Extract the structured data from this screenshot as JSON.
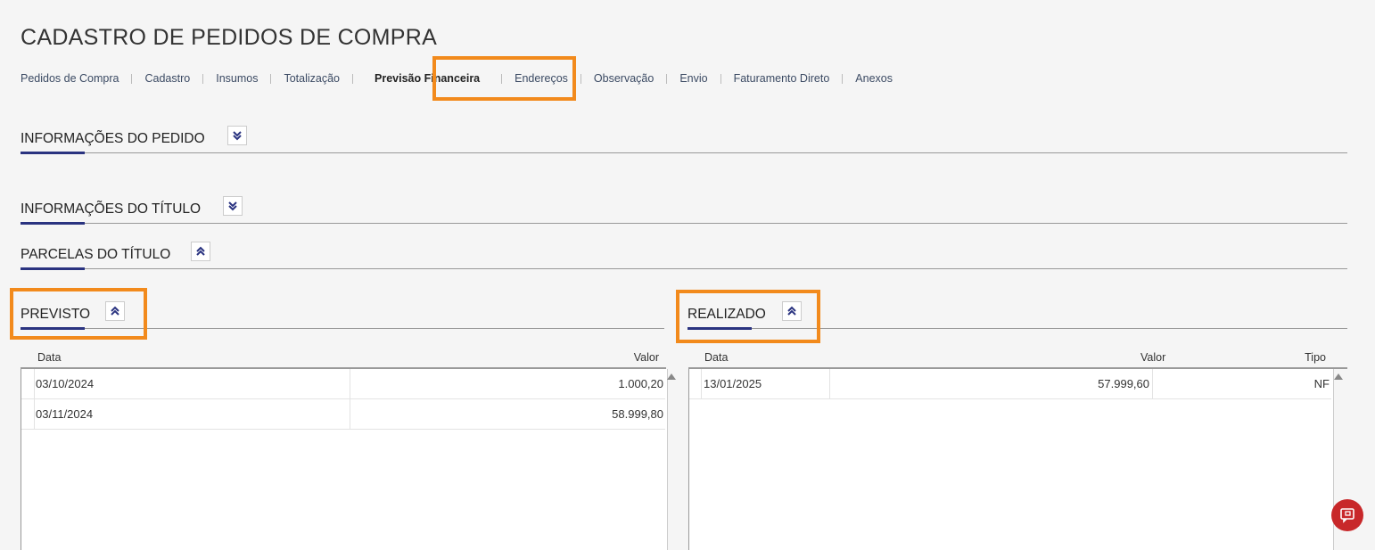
{
  "page": {
    "title": "CADASTRO DE PEDIDOS DE COMPRA"
  },
  "tabs": [
    {
      "label": "Pedidos de Compra"
    },
    {
      "label": "Cadastro"
    },
    {
      "label": "Insumos"
    },
    {
      "label": "Totalização"
    },
    {
      "label": "Previsão Financeira"
    },
    {
      "label": "Endereços"
    },
    {
      "label": "Observação"
    },
    {
      "label": "Envio"
    },
    {
      "label": "Faturamento Direto"
    },
    {
      "label": "Anexos"
    }
  ],
  "active_tab": "Previsão Financeira",
  "sections": {
    "pedido": "INFORMAÇÕES DO PEDIDO",
    "titulo": "INFORMAÇÕES DO TÍTULO",
    "parcelas": "PARCELAS DO TÍTULO"
  },
  "previsto": {
    "title": "PREVISTO",
    "columns": {
      "data": "Data",
      "valor": "Valor"
    },
    "rows": [
      {
        "data": "03/10/2024",
        "valor": "1.000,20"
      },
      {
        "data": "03/11/2024",
        "valor": "58.999,80"
      }
    ]
  },
  "realizado": {
    "title": "REALIZADO",
    "columns": {
      "data": "Data",
      "valor": "Valor",
      "tipo": "Tipo"
    },
    "rows": [
      {
        "data": "13/01/2025",
        "valor": "57.999,60",
        "tipo": "NF"
      }
    ]
  },
  "colors": {
    "accent": "#2a3380",
    "highlight": "#f28a1c",
    "fab": "#c8282a"
  },
  "icons": {
    "expand": "chevron-double-down-icon",
    "collapse": "chevron-double-up-icon",
    "fab": "feedback-icon"
  }
}
